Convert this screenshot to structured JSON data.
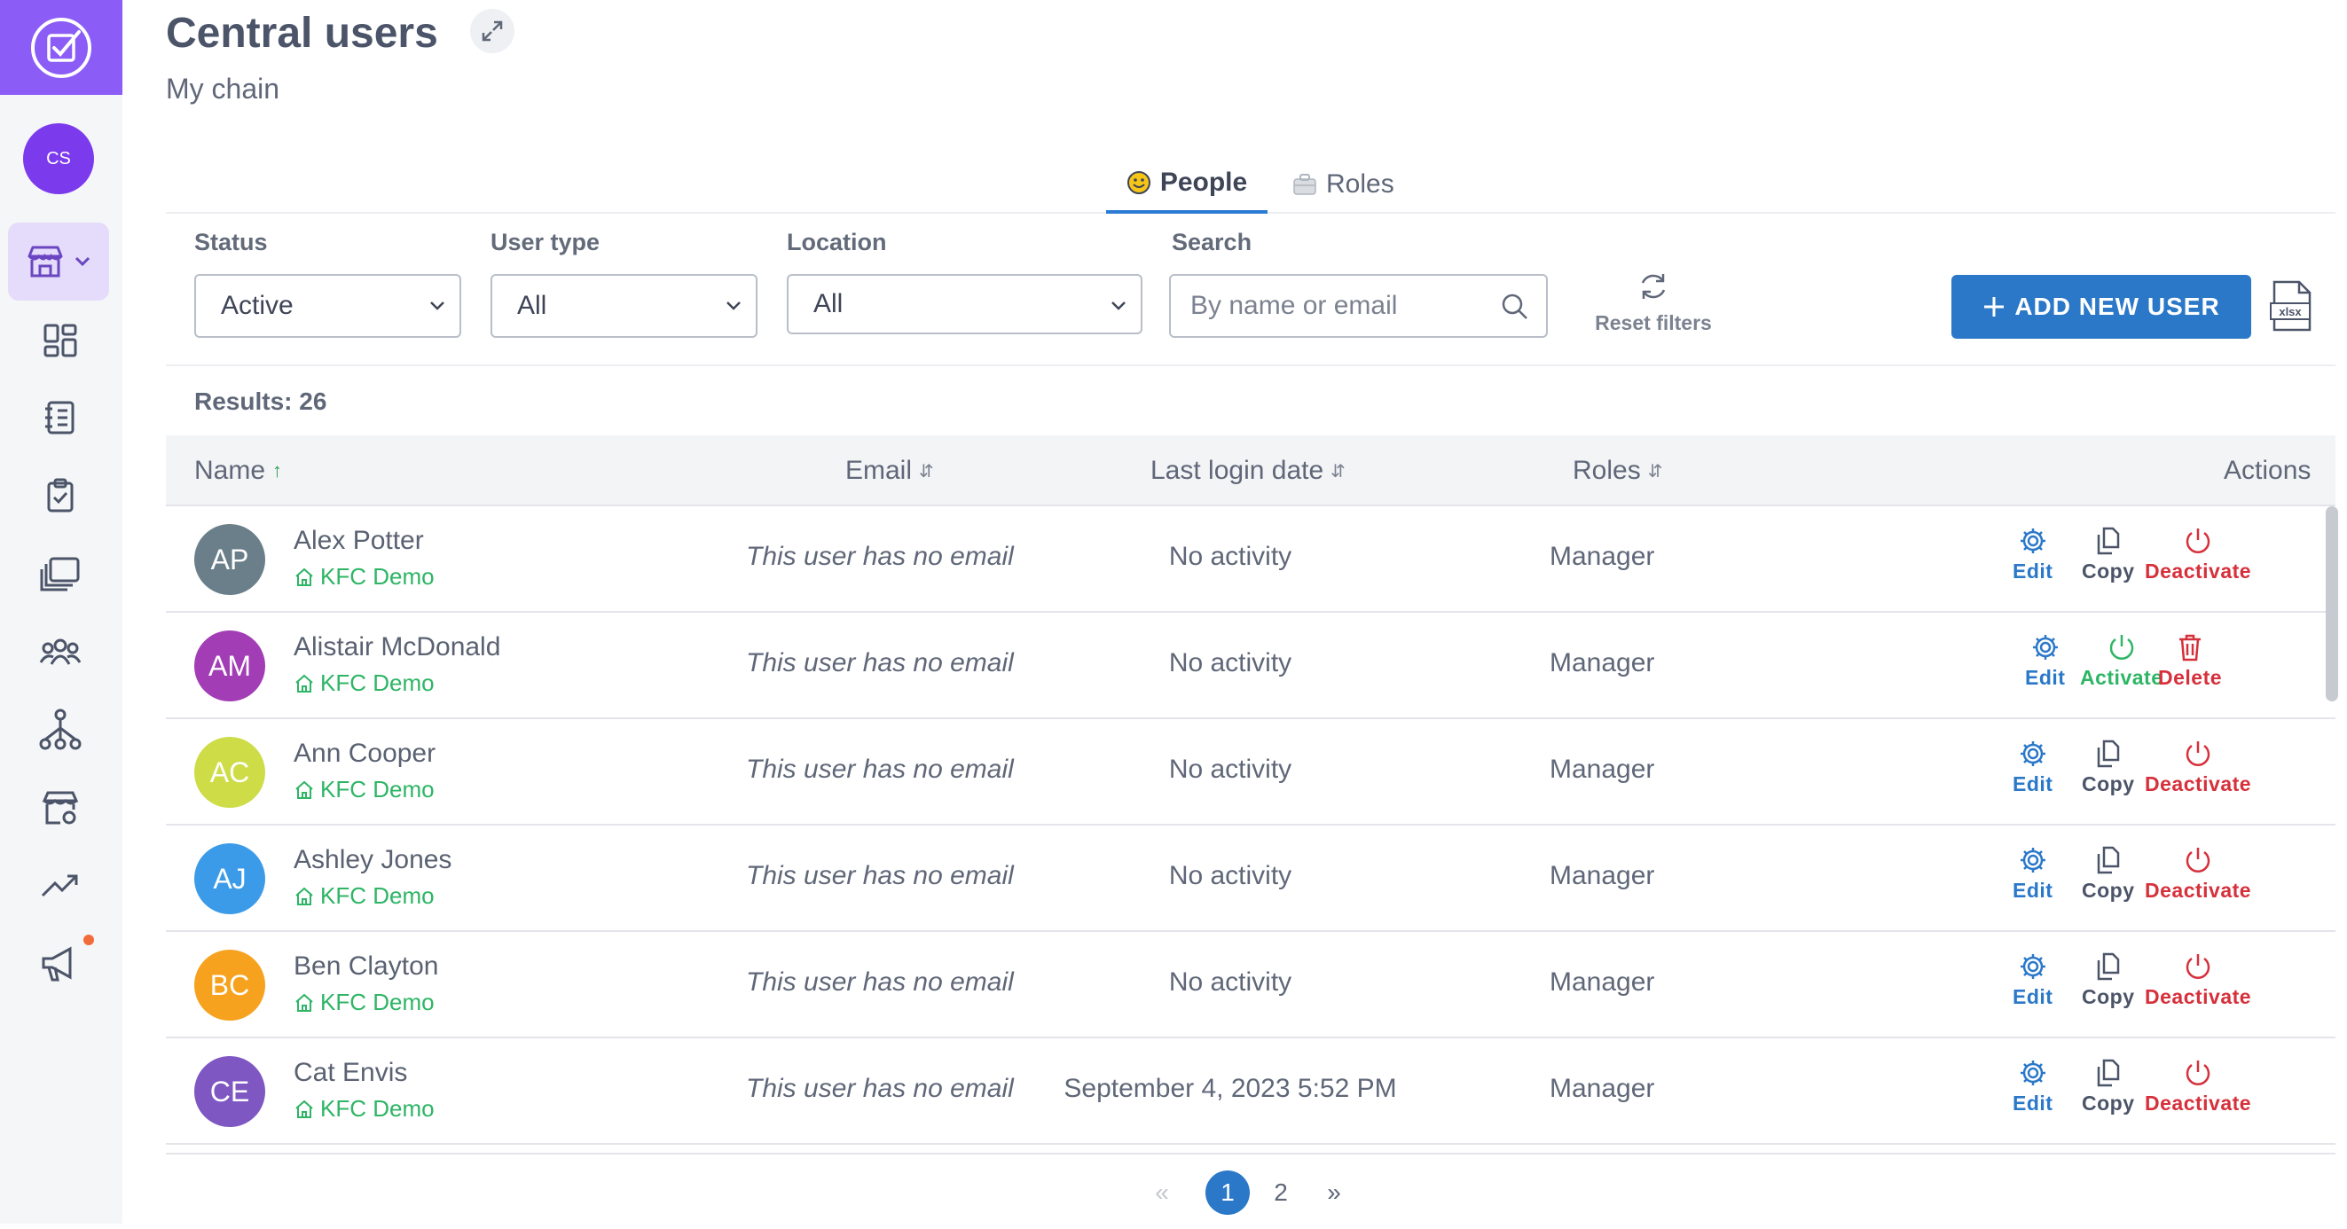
{
  "header": {
    "title": "Central users",
    "subtitle": "My chain"
  },
  "sidebar": {
    "avatar_initials": "CS",
    "items": [
      "store-icon",
      "dashboard-icon",
      "notebook-icon",
      "clipboard-check-icon",
      "gallery-icon",
      "team-icon",
      "hierarchy-icon",
      "store-settings-icon",
      "trending-icon",
      "megaphone-icon"
    ]
  },
  "tabs": [
    {
      "label": "People",
      "icon": "smiley-icon",
      "active": true
    },
    {
      "label": "Roles",
      "icon": "briefcase-icon",
      "active": false
    }
  ],
  "filters": {
    "status": {
      "label": "Status",
      "value": "Active"
    },
    "user_type": {
      "label": "User type",
      "value": "All"
    },
    "location": {
      "label": "Location",
      "value": "All"
    },
    "search": {
      "label": "Search",
      "placeholder": "By name or email"
    },
    "reset_label": "Reset filters"
  },
  "add_button_label": "ADD NEW USER",
  "results_text": "Results: 26",
  "table": {
    "headers": {
      "name": "Name",
      "email": "Email",
      "last_login": "Last login date",
      "roles": "Roles",
      "actions": "Actions"
    },
    "rows": [
      {
        "initials": "AP",
        "color": "#6b7f8a",
        "name": "Alex Potter",
        "location": "KFC Demo",
        "email": "This user has no email",
        "last_login": "No activity",
        "role": "Manager",
        "actions": [
          "Edit",
          "Copy",
          "Deactivate"
        ]
      },
      {
        "initials": "AM",
        "color": "#a23db5",
        "name": "Alistair McDonald",
        "location": "KFC Demo",
        "email": "This user has no email",
        "last_login": "No activity",
        "role": "Manager",
        "actions": [
          "Edit",
          "Activate",
          "Delete"
        ]
      },
      {
        "initials": "AC",
        "color": "#cddc47",
        "name": "Ann Cooper",
        "location": "KFC Demo",
        "email": "This user has no email",
        "last_login": "No activity",
        "role": "Manager",
        "actions": [
          "Edit",
          "Copy",
          "Deactivate"
        ]
      },
      {
        "initials": "AJ",
        "color": "#3c9be8",
        "name": "Ashley Jones",
        "location": "KFC Demo",
        "email": "This user has no email",
        "last_login": "No activity",
        "role": "Manager",
        "actions": [
          "Edit",
          "Copy",
          "Deactivate"
        ]
      },
      {
        "initials": "BC",
        "color": "#f7a21e",
        "name": "Ben Clayton",
        "location": "KFC Demo",
        "email": "This user has no email",
        "last_login": "No activity",
        "role": "Manager",
        "actions": [
          "Edit",
          "Copy",
          "Deactivate"
        ]
      },
      {
        "initials": "CE",
        "color": "#7e57c2",
        "name": "Cat Envis",
        "location": "KFC Demo",
        "email": "This user has no email",
        "last_login": "September 4, 2023 5:52 PM",
        "role": "Manager",
        "actions": [
          "Edit",
          "Copy",
          "Deactivate"
        ]
      }
    ]
  },
  "pagination": {
    "prev": "«",
    "pages": [
      "1",
      "2"
    ],
    "current": "1",
    "next": "»"
  },
  "colors": {
    "primary": "#2b78c9",
    "brand": "#8b5cf6",
    "success": "#2eb565",
    "danger": "#d6303b"
  }
}
